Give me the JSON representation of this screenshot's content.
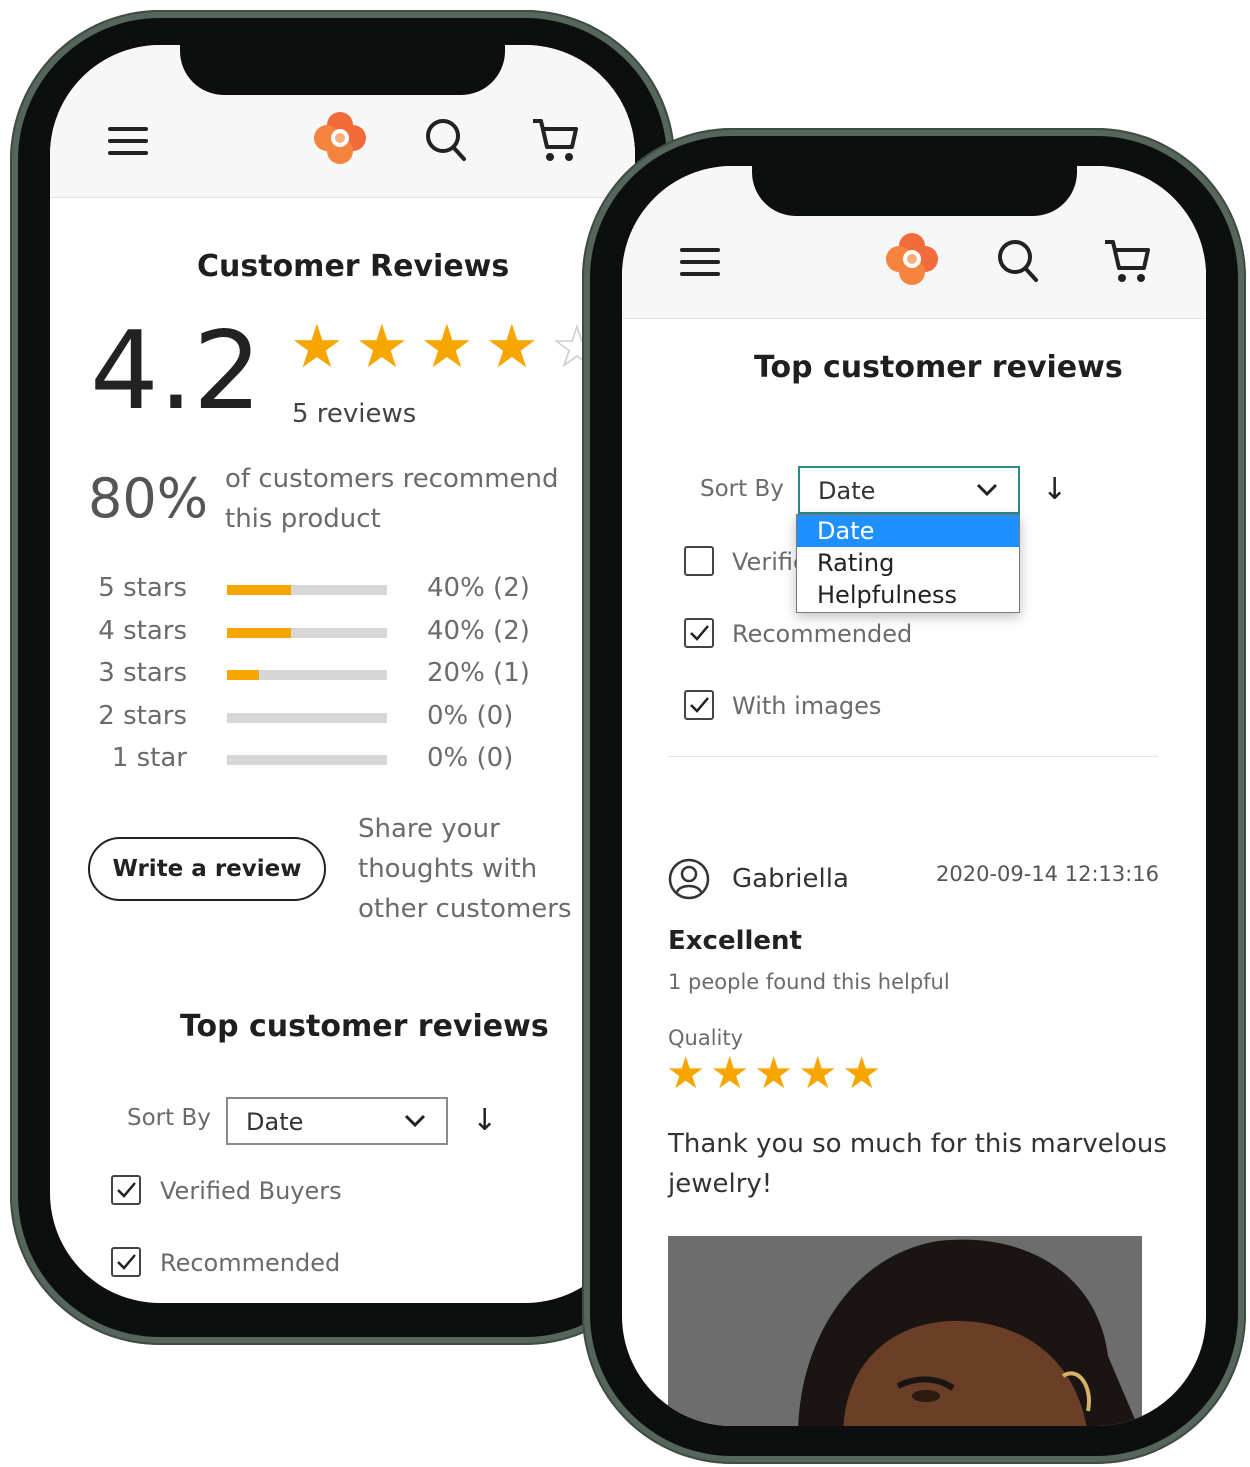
{
  "left_phone": {
    "section_title": "Customer Reviews",
    "rating": "4.2",
    "reviews_count": "5 reviews",
    "recommend_percent": "80%",
    "recommend_text": "of customers recommend this product",
    "distribution": [
      {
        "label": "5 stars",
        "fraction": 0.4,
        "text": "40% (2)"
      },
      {
        "label": "4 stars",
        "fraction": 0.4,
        "text": "40% (2)"
      },
      {
        "label": "3 stars",
        "fraction": 0.2,
        "text": "20% (1)"
      },
      {
        "label": "2 stars",
        "fraction": 0.0,
        "text": "0% (0)"
      },
      {
        "label": "1 star",
        "fraction": 0.0,
        "text": "0% (0)"
      }
    ],
    "write_review_button": "Write a review",
    "share_text": "Share your thoughts with other customers",
    "top_reviews_title": "Top customer reviews",
    "sort_label": "Sort By",
    "sort_value": "Date",
    "filters": [
      {
        "label": "Verified Buyers",
        "checked": true
      },
      {
        "label": "Recommended",
        "checked": true
      }
    ]
  },
  "right_phone": {
    "top_reviews_title": "Top customer reviews",
    "sort_label": "Sort By",
    "sort_value": "Date",
    "sort_options": [
      "Date",
      "Rating",
      "Helpfulness"
    ],
    "sort_selected_index": 0,
    "filters": [
      {
        "label": "Verifie",
        "checked": false
      },
      {
        "label": "Recommended",
        "checked": true
      },
      {
        "label": "With images",
        "checked": true
      }
    ],
    "review": {
      "author": "Gabriella",
      "timestamp": "2020-09-14 12:13:16",
      "headline": "Excellent",
      "helpful_text": "1 people found this helpful",
      "quality_label": "Quality",
      "quality_stars": 5,
      "body": "Thank you so much for this marvelous jewelry!"
    }
  },
  "icons": [
    "menu-icon",
    "logo-icon",
    "search-icon",
    "cart-icon",
    "star-icon",
    "user-avatar-icon",
    "chevron-down-icon",
    "sort-direction-icon",
    "checkbox-icon"
  ],
  "colors": {
    "star": "#f7a600",
    "logo": "#f26b3a",
    "dropdown_selected": "#1e90ff",
    "select_border_active": "#2a8a86"
  }
}
